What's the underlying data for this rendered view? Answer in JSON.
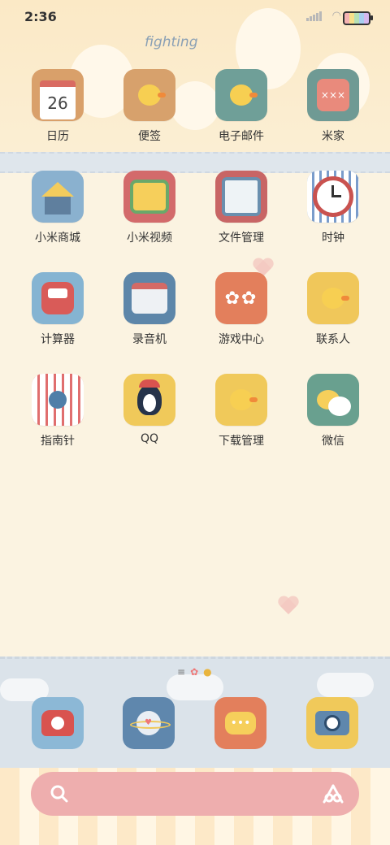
{
  "status_bar": {
    "time": "2:36"
  },
  "wallpaper": {
    "text": "fighting"
  },
  "apps": [
    {
      "label": "日历",
      "icon": "calendar-icon",
      "icon_text": "26",
      "color": "#d9a06a"
    },
    {
      "label": "便签",
      "icon": "notes-duck-icon",
      "color": "#d7a16c"
    },
    {
      "label": "电子邮件",
      "icon": "email-duck-icon",
      "color": "#6f9f98"
    },
    {
      "label": "米家",
      "icon": "mijia-icon",
      "color": "#6f9a94"
    },
    {
      "label": "小米商城",
      "icon": "mi-store-house-icon",
      "color": "#8ab1cf"
    },
    {
      "label": "小米视频",
      "icon": "tv-icon",
      "color": "#d36a6b"
    },
    {
      "label": "文件管理",
      "icon": "file-manager-icon",
      "color": "#c86565"
    },
    {
      "label": "时钟",
      "icon": "clock-icon",
      "color": "#7a9ccb"
    },
    {
      "label": "计算器",
      "icon": "calculator-icon",
      "color": "#85b4d2"
    },
    {
      "label": "录音机",
      "icon": "recorder-icon",
      "color": "#5d86a9"
    },
    {
      "label": "游戏中心",
      "icon": "flowers-icon",
      "color": "#e37f5c"
    },
    {
      "label": "联系人",
      "icon": "contacts-duck-icon",
      "color": "#f0c75a"
    },
    {
      "label": "指南针",
      "icon": "compass-icon",
      "color": "#e6a3a0"
    },
    {
      "label": "QQ",
      "icon": "penguin-icon",
      "color": "#f0c95a"
    },
    {
      "label": "下载管理",
      "icon": "download-duck-icon",
      "color": "#f0c95a"
    },
    {
      "label": "微信",
      "icon": "wechat-icon",
      "color": "#69a08f"
    }
  ],
  "dock": [
    {
      "icon": "phone-icon",
      "color": "#8cb8d6"
    },
    {
      "icon": "browser-planet-icon",
      "color": "#5f87ad"
    },
    {
      "icon": "messages-icon",
      "color": "#e37f5c"
    },
    {
      "icon": "camera-icon",
      "color": "#f0c95a"
    }
  ],
  "search_bar": {
    "color": "#eeaeae"
  }
}
